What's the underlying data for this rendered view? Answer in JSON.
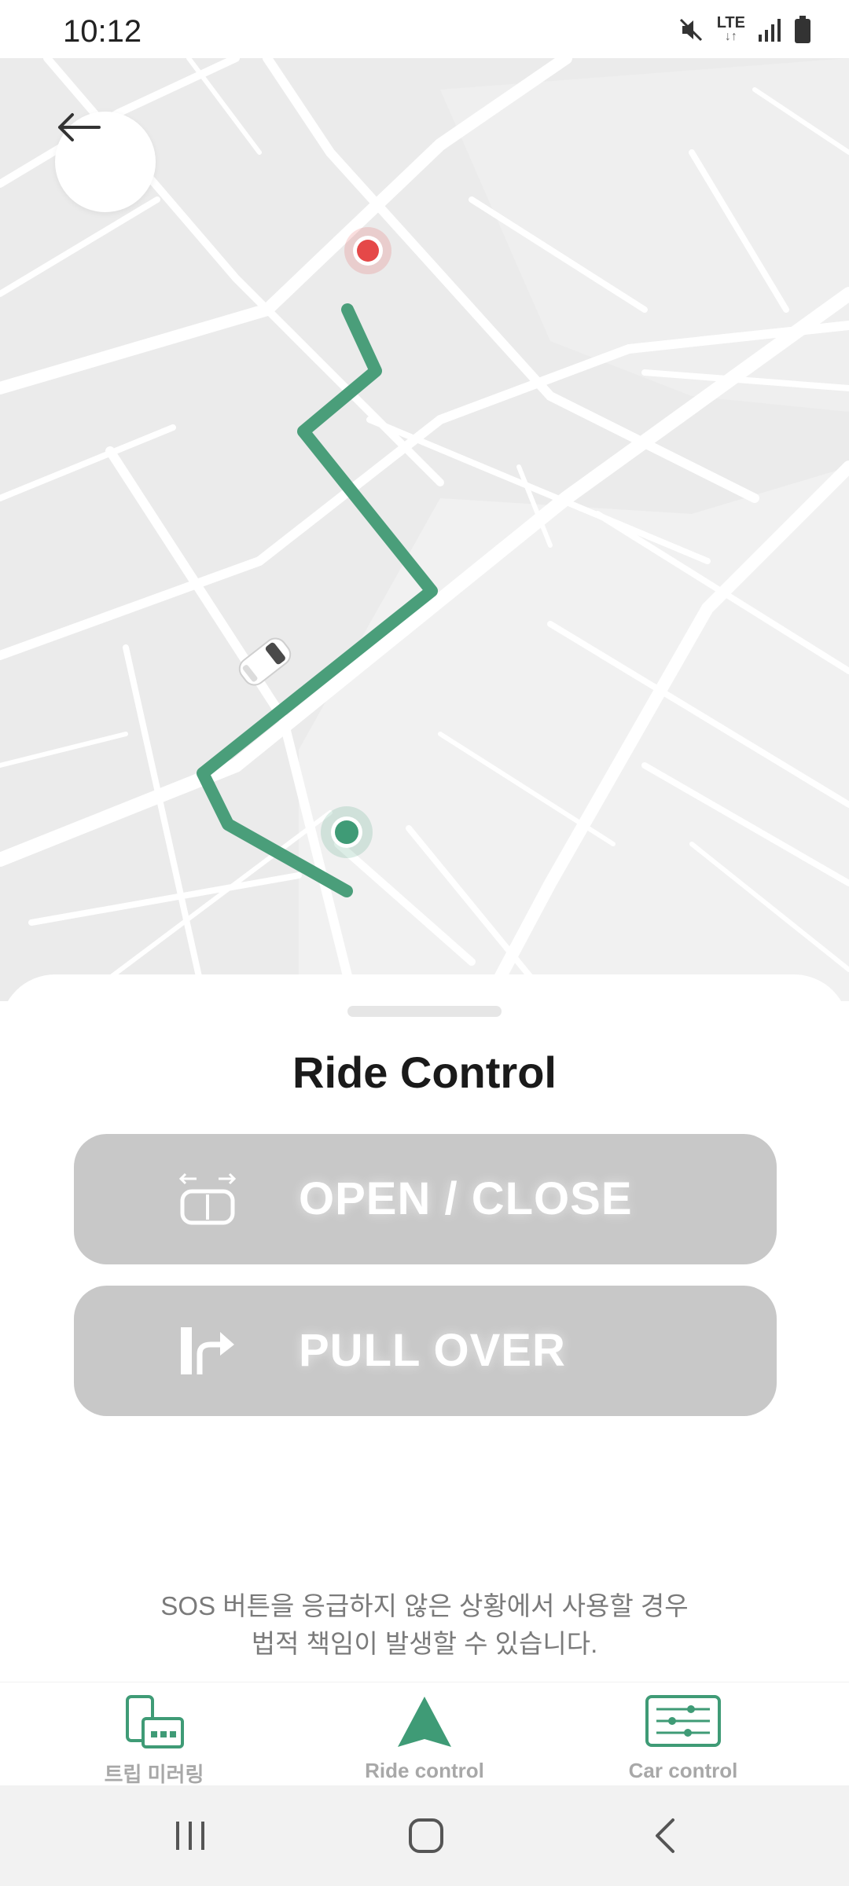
{
  "status_bar": {
    "time": "10:12",
    "network": "LTE",
    "icons": [
      "mute-icon",
      "lte-data-icon",
      "signal-icon",
      "battery-icon"
    ]
  },
  "map": {
    "icons": [
      "back-arrow-icon",
      "destination-pin-icon",
      "origin-pin-icon",
      "car-icon"
    ],
    "colors": {
      "route": "#4a9e7a",
      "destination": "#e54848",
      "origin": "#3f9b76",
      "background": "#ebebeb",
      "roads": "#ffffff"
    }
  },
  "sheet": {
    "title": "Ride Control",
    "buttons": [
      {
        "label": "OPEN / CLOSE",
        "icon": "door-open-close-icon"
      },
      {
        "label": "PULL OVER",
        "icon": "pull-over-icon"
      }
    ],
    "sos_notice_line1": "SOS 버튼을 응급하지 않은 상황에서 사용할 경우",
    "sos_notice_line2": "법적 책임이 발생할 수 있습니다."
  },
  "bottom_nav": {
    "items": [
      {
        "label": "트립 미러링",
        "icon": "trip-mirroring-icon"
      },
      {
        "label": "Ride control",
        "icon": "navigation-arrow-icon"
      },
      {
        "label": "Car control",
        "icon": "sliders-icon"
      }
    ],
    "accent_color": "#3f9b76"
  },
  "system_nav": {
    "icons": [
      "recent-apps-icon",
      "home-icon",
      "back-icon"
    ]
  }
}
